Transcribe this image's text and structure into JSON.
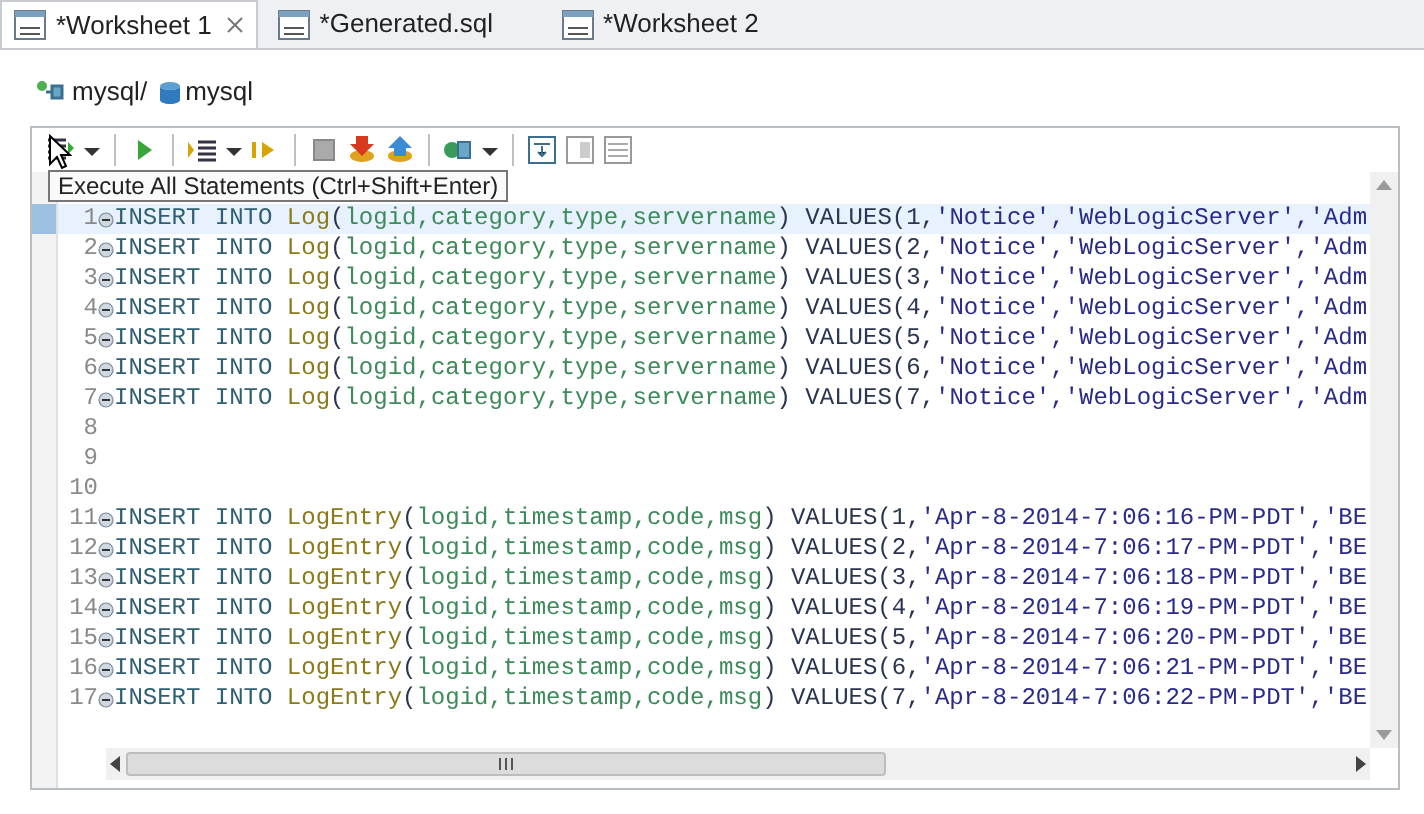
{
  "tabs": [
    {
      "label": "*Worksheet 1",
      "selected": true,
      "closable": true
    },
    {
      "label": "*Generated.sql",
      "selected": false,
      "closable": false
    },
    {
      "label": "*Worksheet 2",
      "selected": false,
      "closable": false
    }
  ],
  "breadcrumb": {
    "connection": "mysql/",
    "database": "mysql"
  },
  "toolbar": [
    {
      "kind": "runall"
    },
    {
      "kind": "caret"
    },
    {
      "kind": "sep"
    },
    {
      "kind": "play"
    },
    {
      "kind": "sep"
    },
    {
      "kind": "runlist"
    },
    {
      "kind": "caret"
    },
    {
      "kind": "step"
    },
    {
      "kind": "sep"
    },
    {
      "kind": "stop"
    },
    {
      "kind": "dbdown"
    },
    {
      "kind": "dbup"
    },
    {
      "kind": "sep"
    },
    {
      "kind": "plug"
    },
    {
      "kind": "caret"
    },
    {
      "kind": "sep"
    },
    {
      "kind": "panel1"
    },
    {
      "kind": "panel2"
    },
    {
      "kind": "panel3"
    }
  ],
  "tooltip": "Execute All Statements (Ctrl+Shift+Enter)",
  "lines": [
    {
      "number": "1",
      "fold": true,
      "current": true,
      "tokens": [
        {
          "kind": "keyword",
          "text": "INSERT INTO "
        },
        {
          "kind": "table",
          "text": "Log"
        },
        {
          "kind": "plain",
          "text": "("
        },
        {
          "kind": "column",
          "text": "logid,category,type,servername"
        },
        {
          "kind": "plain",
          "text": ") VALUES(1,"
        },
        {
          "kind": "string",
          "text": "'Notice','WebLogicServer','Adm"
        }
      ]
    },
    {
      "number": "2",
      "fold": true,
      "current": false,
      "tokens": [
        {
          "kind": "keyword",
          "text": "INSERT INTO "
        },
        {
          "kind": "table",
          "text": "Log"
        },
        {
          "kind": "plain",
          "text": "("
        },
        {
          "kind": "column",
          "text": "logid,category,type,servername"
        },
        {
          "kind": "plain",
          "text": ") VALUES(2,"
        },
        {
          "kind": "string",
          "text": "'Notice','WebLogicServer','Adm"
        }
      ]
    },
    {
      "number": "3",
      "fold": true,
      "current": false,
      "tokens": [
        {
          "kind": "keyword",
          "text": "INSERT INTO "
        },
        {
          "kind": "table",
          "text": "Log"
        },
        {
          "kind": "plain",
          "text": "("
        },
        {
          "kind": "column",
          "text": "logid,category,type,servername"
        },
        {
          "kind": "plain",
          "text": ") VALUES(3,"
        },
        {
          "kind": "string",
          "text": "'Notice','WebLogicServer','Adm"
        }
      ]
    },
    {
      "number": "4",
      "fold": true,
      "current": false,
      "tokens": [
        {
          "kind": "keyword",
          "text": "INSERT INTO "
        },
        {
          "kind": "table",
          "text": "Log"
        },
        {
          "kind": "plain",
          "text": "("
        },
        {
          "kind": "column",
          "text": "logid,category,type,servername"
        },
        {
          "kind": "plain",
          "text": ") VALUES(4,"
        },
        {
          "kind": "string",
          "text": "'Notice','WebLogicServer','Adm"
        }
      ]
    },
    {
      "number": "5",
      "fold": true,
      "current": false,
      "tokens": [
        {
          "kind": "keyword",
          "text": "INSERT INTO "
        },
        {
          "kind": "table",
          "text": "Log"
        },
        {
          "kind": "plain",
          "text": "("
        },
        {
          "kind": "column",
          "text": "logid,category,type,servername"
        },
        {
          "kind": "plain",
          "text": ") VALUES(5,"
        },
        {
          "kind": "string",
          "text": "'Notice','WebLogicServer','Adm"
        }
      ]
    },
    {
      "number": "6",
      "fold": true,
      "current": false,
      "tokens": [
        {
          "kind": "keyword",
          "text": "INSERT INTO "
        },
        {
          "kind": "table",
          "text": "Log"
        },
        {
          "kind": "plain",
          "text": "("
        },
        {
          "kind": "column",
          "text": "logid,category,type,servername"
        },
        {
          "kind": "plain",
          "text": ") VALUES(6,"
        },
        {
          "kind": "string",
          "text": "'Notice','WebLogicServer','Adm"
        }
      ]
    },
    {
      "number": "7",
      "fold": true,
      "current": false,
      "tokens": [
        {
          "kind": "keyword",
          "text": "INSERT INTO "
        },
        {
          "kind": "table",
          "text": "Log"
        },
        {
          "kind": "plain",
          "text": "("
        },
        {
          "kind": "column",
          "text": "logid,category,type,servername"
        },
        {
          "kind": "plain",
          "text": ") VALUES(7,"
        },
        {
          "kind": "string",
          "text": "'Notice','WebLogicServer','Adm"
        }
      ]
    },
    {
      "number": "8",
      "fold": false,
      "current": false
    },
    {
      "number": "9",
      "fold": false,
      "current": false
    },
    {
      "number": "10",
      "fold": false,
      "current": false
    },
    {
      "number": "11",
      "fold": true,
      "current": false,
      "tokens": [
        {
          "kind": "keyword",
          "text": "INSERT INTO "
        },
        {
          "kind": "table",
          "text": "LogEntry"
        },
        {
          "kind": "plain",
          "text": "("
        },
        {
          "kind": "column",
          "text": "logid,timestamp,code,msg"
        },
        {
          "kind": "plain",
          "text": ") VALUES(1,"
        },
        {
          "kind": "string",
          "text": "'Apr-8-2014-7:06:16-PM-PDT','BE"
        }
      ]
    },
    {
      "number": "12",
      "fold": true,
      "current": false,
      "tokens": [
        {
          "kind": "keyword",
          "text": "INSERT INTO "
        },
        {
          "kind": "table",
          "text": "LogEntry"
        },
        {
          "kind": "plain",
          "text": "("
        },
        {
          "kind": "column",
          "text": "logid,timestamp,code,msg"
        },
        {
          "kind": "plain",
          "text": ") VALUES(2,"
        },
        {
          "kind": "string",
          "text": "'Apr-8-2014-7:06:17-PM-PDT','BE"
        }
      ]
    },
    {
      "number": "13",
      "fold": true,
      "current": false,
      "tokens": [
        {
          "kind": "keyword",
          "text": "INSERT INTO "
        },
        {
          "kind": "table",
          "text": "LogEntry"
        },
        {
          "kind": "plain",
          "text": "("
        },
        {
          "kind": "column",
          "text": "logid,timestamp,code,msg"
        },
        {
          "kind": "plain",
          "text": ") VALUES(3,"
        },
        {
          "kind": "string",
          "text": "'Apr-8-2014-7:06:18-PM-PDT','BE"
        }
      ]
    },
    {
      "number": "14",
      "fold": true,
      "current": false,
      "tokens": [
        {
          "kind": "keyword",
          "text": "INSERT INTO "
        },
        {
          "kind": "table",
          "text": "LogEntry"
        },
        {
          "kind": "plain",
          "text": "("
        },
        {
          "kind": "column",
          "text": "logid,timestamp,code,msg"
        },
        {
          "kind": "plain",
          "text": ") VALUES(4,"
        },
        {
          "kind": "string",
          "text": "'Apr-8-2014-7:06:19-PM-PDT','BE"
        }
      ]
    },
    {
      "number": "15",
      "fold": true,
      "current": false,
      "tokens": [
        {
          "kind": "keyword",
          "text": "INSERT INTO "
        },
        {
          "kind": "table",
          "text": "LogEntry"
        },
        {
          "kind": "plain",
          "text": "("
        },
        {
          "kind": "column",
          "text": "logid,timestamp,code,msg"
        },
        {
          "kind": "plain",
          "text": ") VALUES(5,"
        },
        {
          "kind": "string",
          "text": "'Apr-8-2014-7:06:20-PM-PDT','BE"
        }
      ]
    },
    {
      "number": "16",
      "fold": true,
      "current": false,
      "tokens": [
        {
          "kind": "keyword",
          "text": "INSERT INTO "
        },
        {
          "kind": "table",
          "text": "LogEntry"
        },
        {
          "kind": "plain",
          "text": "("
        },
        {
          "kind": "column",
          "text": "logid,timestamp,code,msg"
        },
        {
          "kind": "plain",
          "text": ") VALUES(6,"
        },
        {
          "kind": "string",
          "text": "'Apr-8-2014-7:06:21-PM-PDT','BE"
        }
      ]
    },
    {
      "number": "17",
      "fold": true,
      "current": false,
      "tokens": [
        {
          "kind": "keyword",
          "text": "INSERT INTO "
        },
        {
          "kind": "table",
          "text": "LogEntry"
        },
        {
          "kind": "plain",
          "text": "("
        },
        {
          "kind": "column",
          "text": "logid,timestamp,code,msg"
        },
        {
          "kind": "plain",
          "text": ") VALUES(7,"
        },
        {
          "kind": "string",
          "text": "'Apr-8-2014-7:06:22-PM-PDT','BE"
        }
      ]
    }
  ]
}
